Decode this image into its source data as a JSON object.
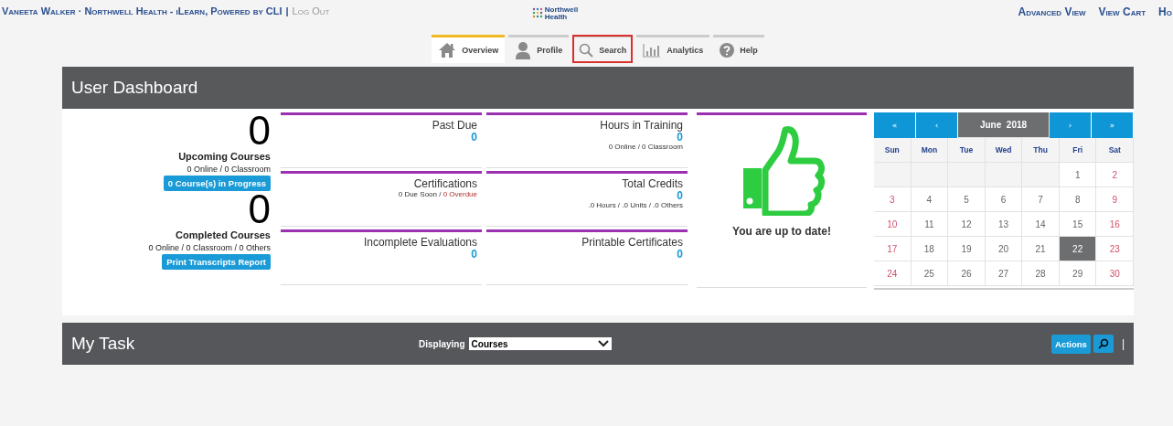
{
  "top_bar": {
    "user_line": "Vaneeta Walker · Northwell Health - iLearn, Powered by CLI",
    "separator": "|",
    "logout": "Log Out",
    "logo": {
      "line1": "Northwell",
      "line2": "Health"
    },
    "links": [
      "Advanced View",
      "View Cart",
      "Ho"
    ]
  },
  "tabs": [
    {
      "label": "Overview",
      "selected": true,
      "highlighted": false
    },
    {
      "label": "Profile",
      "selected": false,
      "highlighted": false
    },
    {
      "label": "Search",
      "selected": false,
      "highlighted": true
    },
    {
      "label": "Analytics",
      "selected": false,
      "highlighted": false
    },
    {
      "label": "Help",
      "selected": false,
      "highlighted": false
    }
  ],
  "dashboard": {
    "title": "User Dashboard",
    "summary": [
      {
        "count": "0",
        "label": "Upcoming Courses",
        "detail": "0 Online / 0 Classroom",
        "button": "0 Course(s) in Progress"
      },
      {
        "count": "0",
        "label": "Completed Courses",
        "detail": "0 Online / 0 Classroom / 0 Others",
        "button": "Print Transcripts Report"
      }
    ],
    "tiles": [
      {
        "title": "Past Due",
        "value": "0"
      },
      {
        "title": "Hours in Training",
        "value": "0",
        "note": "0 Online / 0 Classroom"
      },
      {
        "title": "Certifications",
        "note": "0 Due Soon / ",
        "note_alert": "0 Overdue"
      },
      {
        "title": "Total Credits",
        "value": "0",
        "note": ".0 Hours / .0 Units / .0 Others"
      },
      {
        "title": "Incomplete Evaluations",
        "value": "0"
      },
      {
        "title": "Printable Certificates",
        "value": "0"
      }
    ],
    "status": {
      "message": "You are up to date!"
    },
    "calendar": {
      "nav_prev_year": "«",
      "nav_prev": "‹",
      "month": "June  2018",
      "nav_next": "›",
      "nav_next_year": "»",
      "weekdays": [
        "Sun",
        "Mon",
        "Tue",
        "Wed",
        "Thu",
        "Fri",
        "Sat"
      ],
      "weeks": [
        [
          {
            "kind": "blank"
          },
          {
            "kind": "blank"
          },
          {
            "kind": "blank"
          },
          {
            "kind": "blank"
          },
          {
            "kind": "blank"
          },
          {
            "kind": "day",
            "day": "1",
            "selected": false
          },
          {
            "kind": "day",
            "day": "2",
            "selected": false
          }
        ],
        [
          {
            "kind": "day",
            "day": "3",
            "selected": false
          },
          {
            "kind": "day",
            "day": "4",
            "selected": false
          },
          {
            "kind": "day",
            "day": "5",
            "selected": false
          },
          {
            "kind": "day",
            "day": "6",
            "selected": false
          },
          {
            "kind": "day",
            "day": "7",
            "selected": false
          },
          {
            "kind": "day",
            "day": "8",
            "selected": false
          },
          {
            "kind": "day",
            "day": "9",
            "selected": false
          }
        ],
        [
          {
            "kind": "day",
            "day": "10",
            "selected": false
          },
          {
            "kind": "day",
            "day": "11",
            "selected": false
          },
          {
            "kind": "day",
            "day": "12",
            "selected": false
          },
          {
            "kind": "day",
            "day": "13",
            "selected": false
          },
          {
            "kind": "day",
            "day": "14",
            "selected": false
          },
          {
            "kind": "day",
            "day": "15",
            "selected": false
          },
          {
            "kind": "day",
            "day": "16",
            "selected": false
          }
        ],
        [
          {
            "kind": "day",
            "day": "17",
            "selected": false
          },
          {
            "kind": "day",
            "day": "18",
            "selected": false
          },
          {
            "kind": "day",
            "day": "19",
            "selected": false
          },
          {
            "kind": "day",
            "day": "20",
            "selected": false
          },
          {
            "kind": "day",
            "day": "21",
            "selected": false
          },
          {
            "kind": "day",
            "day": "22",
            "selected": true
          },
          {
            "kind": "day",
            "day": "23",
            "selected": false
          }
        ],
        [
          {
            "kind": "day",
            "day": "24",
            "selected": false
          },
          {
            "kind": "day",
            "day": "25",
            "selected": false
          },
          {
            "kind": "day",
            "day": "26",
            "selected": false
          },
          {
            "kind": "day",
            "day": "27",
            "selected": false
          },
          {
            "kind": "day",
            "day": "28",
            "selected": false
          },
          {
            "kind": "day",
            "day": "29",
            "selected": false
          },
          {
            "kind": "day",
            "day": "30",
            "selected": false
          }
        ]
      ]
    }
  },
  "my_task": {
    "title": "My Task",
    "displaying_label": "Displaying",
    "displaying_value": "Courses",
    "actions": "Actions",
    "divider": "|"
  }
}
